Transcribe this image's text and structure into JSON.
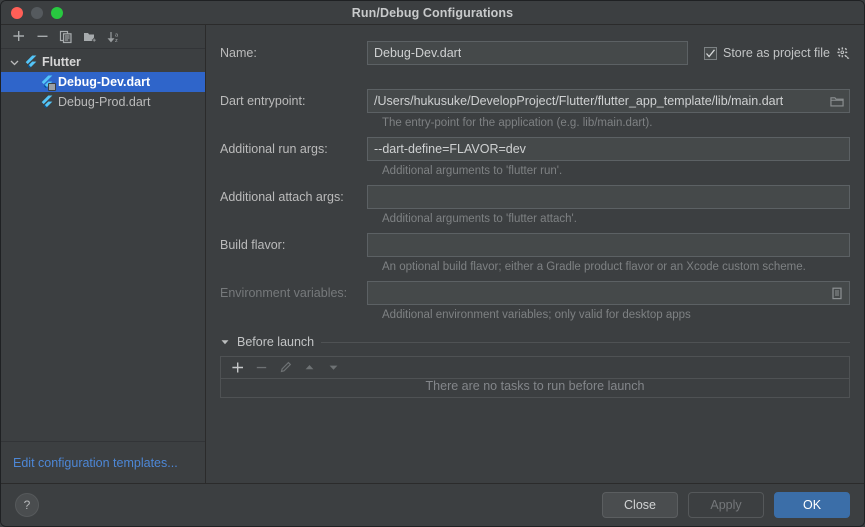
{
  "window": {
    "title": "Run/Debug Configurations",
    "traffic_lights": [
      "close",
      "minimize",
      "zoom"
    ]
  },
  "left_panel": {
    "toolbar": [
      {
        "name": "add-configuration-button",
        "icon": "plus-icon"
      },
      {
        "name": "remove-configuration-button",
        "icon": "minus-icon"
      },
      {
        "name": "copy-configuration-button",
        "icon": "copy-icon"
      },
      {
        "name": "new-folder-button",
        "icon": "folder-add-icon"
      },
      {
        "name": "sort-configurations-button",
        "icon": "sort-alpha-down-icon"
      }
    ],
    "tree": [
      {
        "label": "Flutter",
        "type": "group",
        "expanded": true,
        "icon": "flutter-icon"
      },
      {
        "label": "Debug-Dev.dart",
        "type": "child",
        "selected": true,
        "icon": "flutter-icon"
      },
      {
        "label": "Debug-Prod.dart",
        "type": "child",
        "selected": false,
        "icon": "flutter-icon"
      }
    ],
    "edit_templates_link": "Edit configuration templates..."
  },
  "form": {
    "name": {
      "label": "Name:",
      "value": "Debug-Dev.dart",
      "placeholder": ""
    },
    "store_as_project_file": {
      "label": "Store as project file",
      "checked": true,
      "gear_icon": "gear-icon"
    },
    "dart_entrypoint": {
      "label": "Dart entrypoint:",
      "value": "/Users/hukusuke/DevelopProject/Flutter/flutter_app_template/lib/main.dart",
      "hint": "The entry-point for the application (e.g. lib/main.dart).",
      "browse_icon": "folder-icon"
    },
    "additional_run_args": {
      "label": "Additional run args:",
      "value": "--dart-define=FLAVOR=dev",
      "hint": "Additional arguments to 'flutter run'."
    },
    "additional_attach_args": {
      "label": "Additional attach args:",
      "value": "",
      "hint": "Additional arguments to 'flutter attach'."
    },
    "build_flavor": {
      "label": "Build flavor:",
      "value": "",
      "hint": "An optional build flavor; either a Gradle product flavor or an Xcode custom scheme."
    },
    "environment_variables": {
      "label": "Environment variables:",
      "value": "",
      "hint": "Additional environment variables; only valid for desktop apps",
      "disabled": true,
      "expand_icon": "list-document-icon"
    }
  },
  "before_launch": {
    "title": "Before launch",
    "expanded": true,
    "toolbar": [
      {
        "name": "add-task-button",
        "icon": "plus-icon",
        "enabled": true
      },
      {
        "name": "remove-task-button",
        "icon": "minus-icon",
        "enabled": false
      },
      {
        "name": "edit-task-button",
        "icon": "pencil-icon",
        "enabled": false
      },
      {
        "name": "move-task-up-button",
        "icon": "triangle-up-icon",
        "enabled": false
      },
      {
        "name": "move-task-down-button",
        "icon": "triangle-down-icon",
        "enabled": false
      }
    ],
    "empty_message": "There are no tasks to run before launch"
  },
  "footer": {
    "help_label": "?",
    "close_label": "Close",
    "apply_label": "Apply",
    "ok_label": "OK"
  },
  "colors": {
    "background": "#3c3f41",
    "selection_blue": "#2f65ca",
    "ok_button_blue": "#3b6ea8",
    "link_blue": "#4d87d6",
    "flutter_blue": "#54c5f8"
  }
}
